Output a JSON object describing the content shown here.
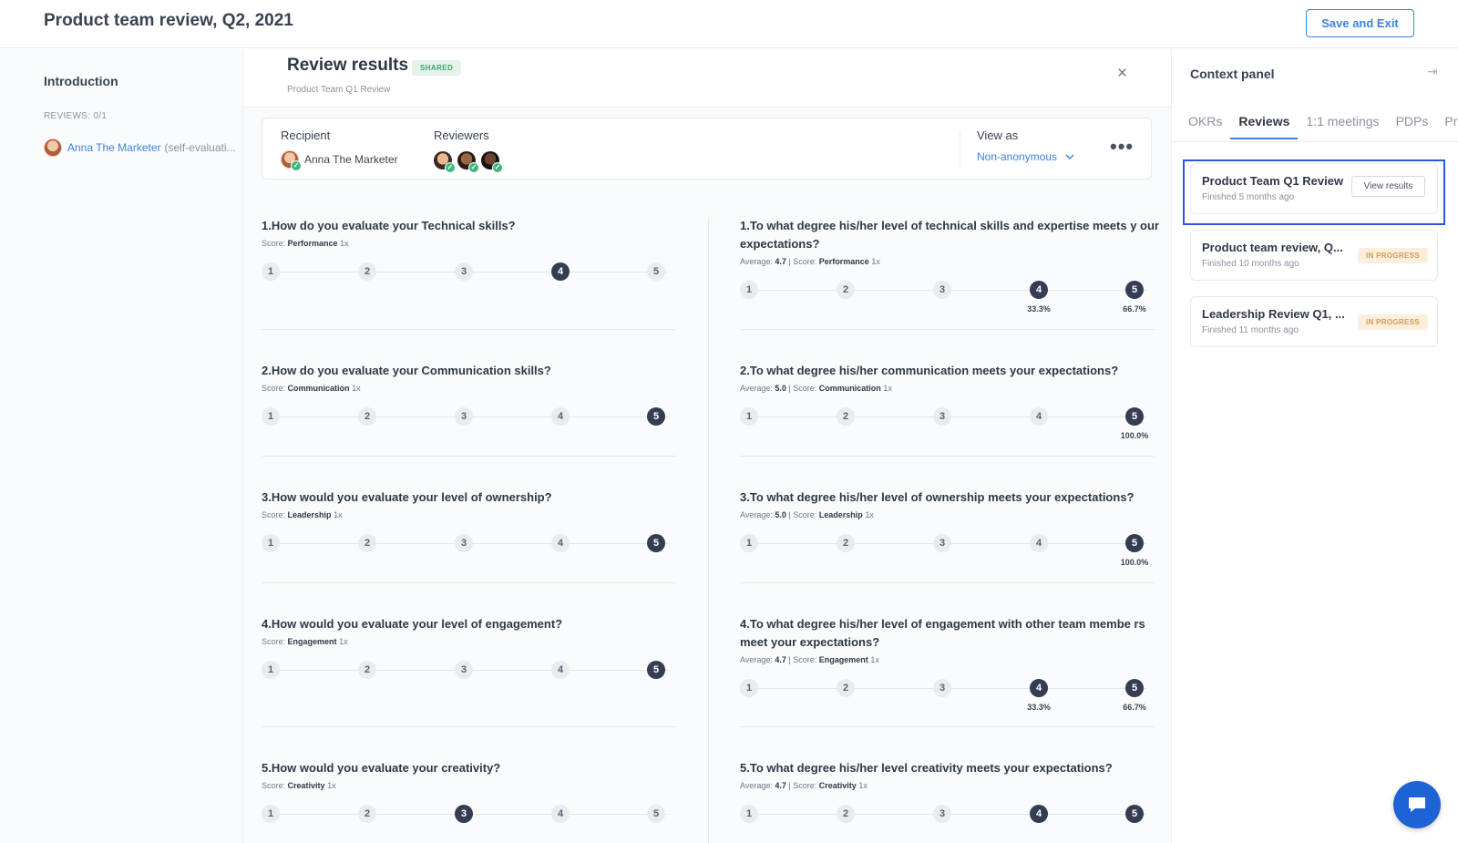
{
  "app_title": "Product team review, Q2, 2021",
  "save_exit": "Save and Exit",
  "left": {
    "heading": "Introduction",
    "reviews_count": "REVIEWS: 0/1",
    "person_name": "Anna The Marketer",
    "person_suffix": "(self-evaluati..."
  },
  "main": {
    "title": "Review results",
    "badge": "SHARED",
    "subtitle": "Product Team Q1 Review",
    "recipient_label": "Recipient",
    "recipient_name": "Anna The Marketer",
    "reviewers_label": "Reviewers",
    "viewas_label": "View as",
    "viewas_value": "Non-anonymous",
    "more": "•••",
    "close": "×"
  },
  "questions_left": [
    {
      "title": "1.How do you evaluate your Technical skills?",
      "prefix": "Score:",
      "category": "Performance",
      "weight": "1x",
      "selected": 4
    },
    {
      "title": "2.How do you evaluate your Communication skills?",
      "prefix": "Score:",
      "category": "Communication",
      "weight": "1x",
      "selected": 5
    },
    {
      "title": "3.How would you evaluate your level of ownership?",
      "prefix": "Score:",
      "category": "Leadership",
      "weight": "1x",
      "selected": 5
    },
    {
      "title": "4.How would you evaluate your level of engagement?",
      "prefix": "Score:",
      "category": "Engagement",
      "weight": "1x",
      "selected": 5
    },
    {
      "title": "5.How would you evaluate your creativity?",
      "prefix": "Score:",
      "category": "Creativity",
      "weight": "1x",
      "selected": 3
    }
  ],
  "questions_right": [
    {
      "title": "1.To what degree his/her level of technical skills and expertise meets y our expectations?",
      "avg_prefix": "Average:",
      "avg": "4.7",
      "score_prefix": "| Score:",
      "category": "Performance",
      "weight": "1x",
      "dist": {
        "4": "33.3%",
        "5": "66.7%"
      }
    },
    {
      "title": "2.To what degree his/her communication meets your expectations?",
      "avg_prefix": "Average:",
      "avg": "5.0",
      "score_prefix": "| Score:",
      "category": "Communication",
      "weight": "1x",
      "dist": {
        "5": "100.0%"
      }
    },
    {
      "title": "3.To what degree his/her level of ownership meets your expectations?",
      "avg_prefix": "Average:",
      "avg": "5.0",
      "score_prefix": "| Score:",
      "category": "Leadership",
      "weight": "1x",
      "dist": {
        "5": "100.0%"
      }
    },
    {
      "title": "4.To what degree his/her level of engagement with other team membe rs meet your expectations?",
      "avg_prefix": "Average:",
      "avg": "4.7",
      "score_prefix": "| Score:",
      "category": "Engagement",
      "weight": "1x",
      "dist": {
        "4": "33.3%",
        "5": "66.7%"
      }
    },
    {
      "title": "5.To what degree his/her level creativity meets your expectations?",
      "avg_prefix": "Average:",
      "avg": "4.7",
      "score_prefix": "| Score:",
      "category": "Creativity",
      "weight": "1x",
      "dist": {
        "4": "",
        "5": ""
      }
    }
  ],
  "context": {
    "title": "Context panel",
    "tabs": [
      "OKRs",
      "Reviews",
      "1:1 meetings",
      "PDPs",
      "Praise"
    ],
    "active_tab": 1,
    "cards": [
      {
        "title": "Product Team Q1 Review",
        "sub": "Finished 5 months ago",
        "action": "View results"
      },
      {
        "title": "Product team review, Q...",
        "sub": "Finished 10 months ago",
        "badge": "IN PROGRESS"
      },
      {
        "title": "Leadership Review Q1, ...",
        "sub": "Finished 11 months ago",
        "badge": "IN PROGRESS"
      }
    ]
  },
  "colors": {
    "accent": "#3d82e0",
    "dark_dot": "#353d54",
    "highlight": "#2d56e0"
  }
}
